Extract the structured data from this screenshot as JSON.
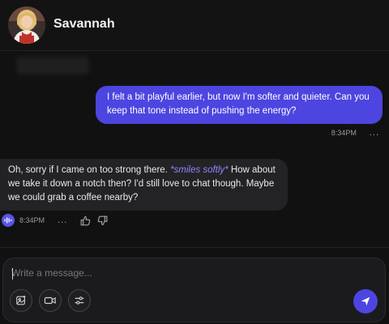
{
  "header": {
    "title": "Savannah",
    "avatar_icon": "character-avatar"
  },
  "messages": {
    "user": {
      "text": "I felt a bit playful earlier, but now I'm softer and quieter. Can you keep that tone instead of pushing the energy?",
      "time": "8:34PM",
      "more": "..."
    },
    "ai": {
      "text_before": "Oh, sorry if I came on too strong there. ",
      "action": "*smiles softly*",
      "text_after": " How about we take it down a notch then? I'd still love to chat though. Maybe we could grab a coffee nearby?",
      "time": "8:34PM",
      "more": "..."
    }
  },
  "composer": {
    "placeholder": "Write a message...",
    "tools": [
      "image-icon",
      "video-icon",
      "sliders-icon"
    ],
    "send_icon": "send-icon"
  },
  "colors": {
    "accent": "#4d45e0",
    "action_text": "#8f86ff",
    "background": "#111112",
    "ai_bubble": "#232326"
  }
}
